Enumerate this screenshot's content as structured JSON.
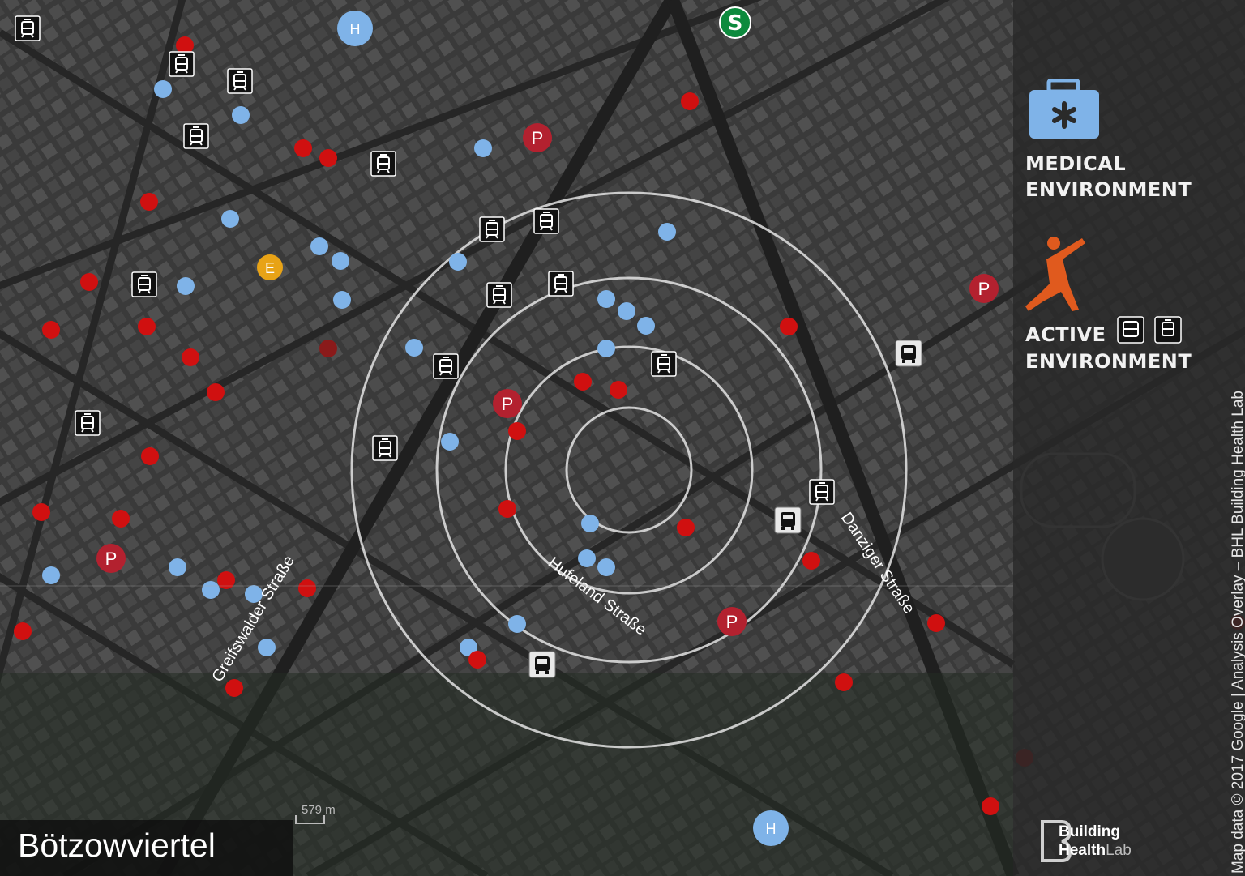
{
  "map": {
    "title": "Bötzowviertel",
    "scale_label": "579 m",
    "streets": [
      "Greifswalder Straße",
      "Hufeland Straße",
      "Danziger Straße"
    ],
    "attribution": "Map data © 2017 Google | Analysis Overlay – BHL Building Health Lab"
  },
  "sidebar": {
    "medical_line1": "MEDICAL",
    "medical_line2": "ENVIRONMENT",
    "active_line1": "ACTIVE",
    "active_line2": "ENVIRONMENT"
  },
  "logo": {
    "word1": "Building",
    "word2": "Health",
    "word3": "Lab"
  },
  "markers": {
    "parking_label": "P",
    "hospital_label": "H",
    "sbahn_label": "S",
    "e_label": "E"
  },
  "colors": {
    "medical_blue": "#7fb3e8",
    "red_point": "#d01010",
    "parking_red": "#b3212f",
    "active_orange": "#e05a1e",
    "e_marker_yellow": "#e8a316",
    "sbahn_green": "#0c8a3d"
  },
  "icons": {
    "tram": "tram-icon",
    "bus": "bus-icon",
    "medical": "medical-case-icon",
    "active": "stretching-person-icon"
  }
}
